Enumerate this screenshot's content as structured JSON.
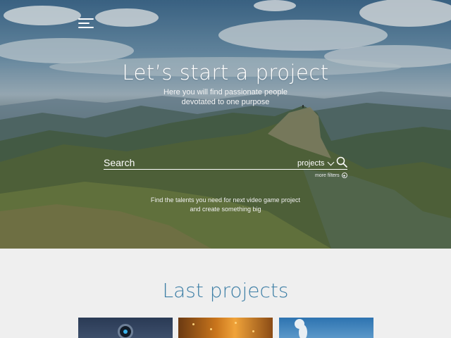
{
  "hero": {
    "title": "Let’s start a project",
    "subtitle_line1": "Here you will find passionate people",
    "subtitle_line2": "devotated to one purpose",
    "tagline_line1": "Find the talents you need for next video game project",
    "tagline_line2": "and create something big"
  },
  "search": {
    "placeholder": "Search",
    "category_selected": "projects",
    "more_filters_label": "more filters"
  },
  "icons": {
    "menu": "hamburger-menu-icon",
    "search": "search-icon",
    "dropdown": "chevron-down-icon",
    "filters": "plus-circle-icon"
  },
  "colors": {
    "accent": "#3e7fa6",
    "section_background": "#efefef"
  },
  "last_projects": {
    "title": "Last projects",
    "items": [
      {
        "image": "camera-lens-in-hand"
      },
      {
        "image": "sparks-warm-light"
      },
      {
        "image": "geyser-blue-sky"
      }
    ]
  }
}
